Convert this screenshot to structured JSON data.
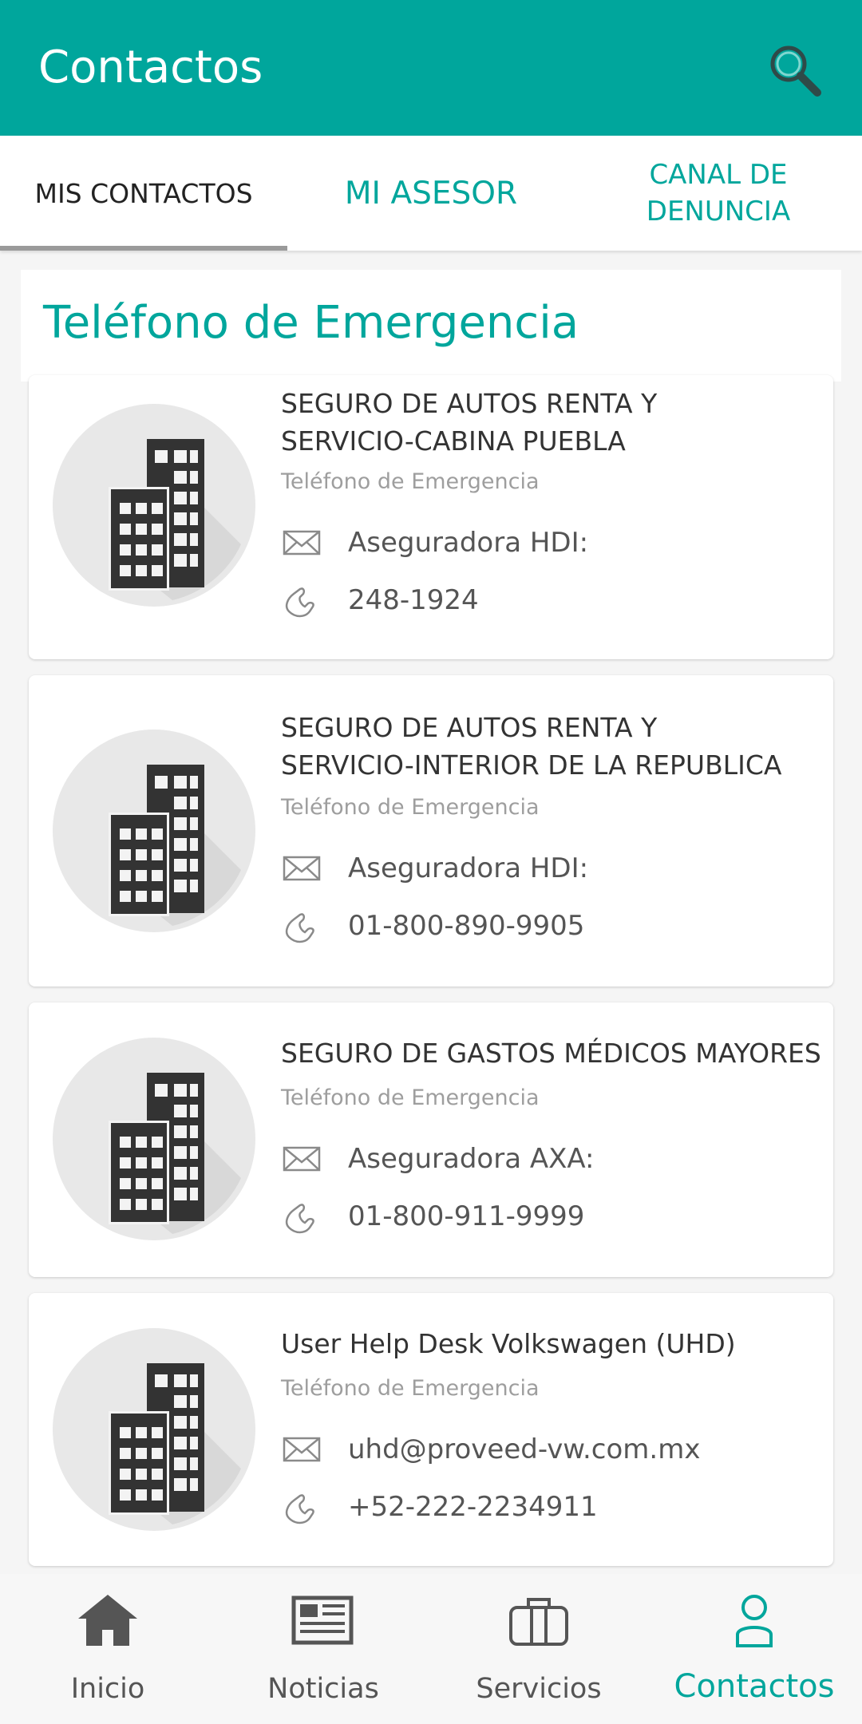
{
  "appbar": {
    "title": "Contactos",
    "icon": "search-icon"
  },
  "tabs": [
    {
      "label": "MIS CONTACTOS",
      "active": true
    },
    {
      "label": "MI ASESOR",
      "active": false
    },
    {
      "label_line1": "CANAL DE",
      "label_line2": "DENUNCIA",
      "active": false
    }
  ],
  "section": {
    "title": "Teléfono de Emergencia"
  },
  "contacts": [
    {
      "name_line1": "SEGURO DE AUTOS RENTA Y",
      "name_line2": "SERVICIO-CABINA PUEBLA",
      "type": "Teléfono de Emergencia",
      "email": "Aseguradora HDI:",
      "phone": "248-1924"
    },
    {
      "name_line1": "SEGURO DE AUTOS RENTA Y",
      "name_line2": "SERVICIO-INTERIOR DE LA REPUBLICA",
      "type": "Teléfono de Emergencia",
      "email": "Aseguradora HDI:",
      "phone": "01-800-890-9905"
    },
    {
      "name_line1": "SEGURO DE GASTOS MÉDICOS MAYORES",
      "type": "Teléfono de Emergencia",
      "email": "Aseguradora AXA:",
      "phone": "01-800-911-9999"
    },
    {
      "name_line1": "User Help Desk Volkswagen (UHD)",
      "type": "Teléfono de Emergencia",
      "email": "uhd@proveed-vw.com.mx",
      "phone": "+52-222-2234911"
    }
  ],
  "bottom_nav": [
    {
      "label": "Inicio",
      "icon": "home-icon"
    },
    {
      "label": "Noticias",
      "icon": "newspaper-icon"
    },
    {
      "label": "Servicios",
      "icon": "briefcase-icon"
    },
    {
      "label": "Contactos",
      "icon": "person-icon",
      "active": true
    }
  ],
  "colors": {
    "primary": "#00a69c",
    "text": "#333333",
    "muted": "#9e9e9e"
  }
}
